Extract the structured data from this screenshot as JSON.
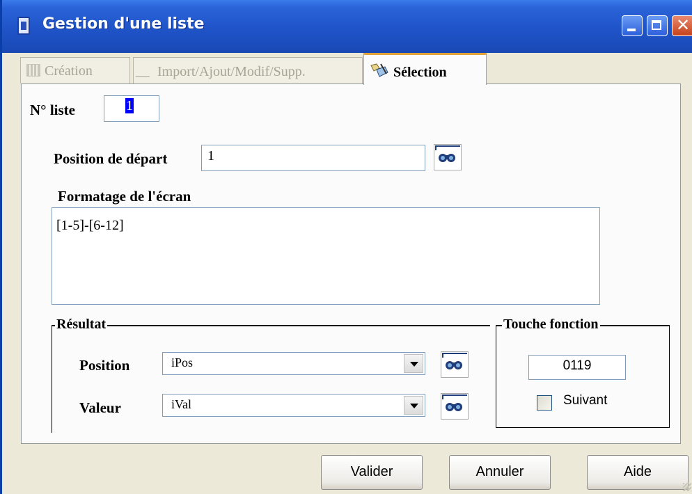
{
  "window": {
    "title": "Gestion d'une liste"
  },
  "tabs": [
    {
      "label": "Création",
      "icon": "grid-icon",
      "enabled": false
    },
    {
      "label": "Import/Ajout/Modif/Supp.",
      "icon": "pen-icon",
      "enabled": false
    },
    {
      "label": "Sélection",
      "icon": "selection-icon",
      "enabled": true,
      "active": true
    }
  ],
  "form": {
    "liste_label": "N° liste",
    "liste_value": "1",
    "position_depart_label": "Position de départ",
    "position_depart_value": "1",
    "formatage_label": "Formatage de l'écran",
    "formatage_value": "[1-5]-[6-12]"
  },
  "resultat": {
    "title": "Résultat",
    "position_label": "Position",
    "position_value": "iPos",
    "valeur_label": "Valeur",
    "valeur_value": "iVal"
  },
  "touche": {
    "title": "Touche fonction",
    "value": "0119",
    "suivant_label": "Suivant",
    "suivant_checked": false
  },
  "buttons": {
    "valider": "Valider",
    "annuler": "Annuler",
    "aide": "Aide"
  },
  "colors": {
    "titlebar": "#1f54c8",
    "selection": "#0000ff",
    "active_tab_accent": "#e0a43a"
  }
}
